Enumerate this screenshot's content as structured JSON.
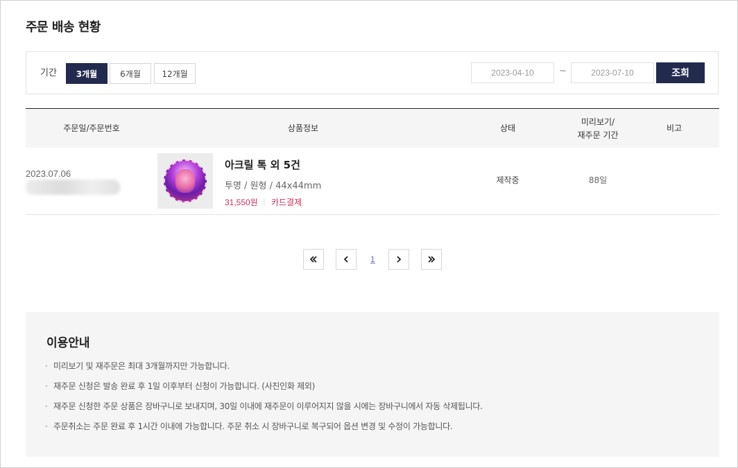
{
  "page": {
    "title": "주문 배송 현황"
  },
  "filter": {
    "label": "기간",
    "periods": [
      "3개월",
      "6개월",
      "12개월"
    ],
    "active_period": "3개월",
    "start_date": "2023-04-10",
    "tilde": "~",
    "end_date": "2023-07-10",
    "search_label": "조회"
  },
  "table": {
    "headers": {
      "order": "주문일/주문번호",
      "product": "상품정보",
      "status": "상태",
      "preview_line1": "미리보기/",
      "preview_line2": "재주문 기간",
      "note": "비고"
    },
    "rows": [
      {
        "order_date": "2023.07.06",
        "product_name": "아크릴 톡 외 5건",
        "product_options": "투명 / 원형 / 44x44mm",
        "price": "31,550원",
        "payment": "카드결제",
        "status": "제작중",
        "period": "88일",
        "note": ""
      }
    ]
  },
  "pagination": {
    "current_page": "1"
  },
  "guide": {
    "title": "이용안내",
    "items": [
      "미리보기 및 재주문은 최대 3개월까지만 가능합니다.",
      "재주문 신청은 발송 완료 후 1일 이후부터 신청이 가능합니다. (사진인화 제외)",
      "재주문 신청한 주문 상품은 장바구니로 보내지며, 30일 이내에 재주문이 이루어지지 않을 시에는 장바구니에서 자동 삭제됩니다.",
      "주문취소는 주문 완료 후 1시간 이내에 가능합니다. 주문 취소 시 장바구니로 복구되어 옵션 변경 및 수정이 가능합니다."
    ]
  },
  "colors": {
    "accent": "#222a4e",
    "price": "#c8315b",
    "page_link": "#6b6bd0"
  },
  "icons": [
    "double-chevron-left-icon",
    "chevron-left-icon",
    "chevron-right-icon",
    "double-chevron-right-icon"
  ]
}
